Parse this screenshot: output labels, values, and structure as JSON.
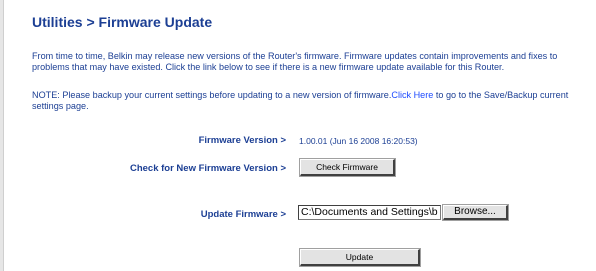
{
  "page": {
    "title": "Utilities > Firmware Update",
    "intro": "From time to time, Belkin may release new versions of the Router's firmware. Firmware updates contain improvements and fixes to problems that may have existed. Click the link below to see if there is a new firmware update available for this Router.",
    "note_prefix": "NOTE: Please backup your current settings before updating to a new version of firmware.",
    "note_link": "Click Here",
    "note_suffix": " to go to the Save/Backup current settings page."
  },
  "firmware": {
    "version_label": "Firmware Version >",
    "version_value": "1.00.01 (Jun 16 2008 16:20:53)",
    "check_label": "Check for New Firmware Version >",
    "check_button": "Check Firmware",
    "update_label": "Update Firmware >",
    "file_value": "C:\\Documents and Settings\\b",
    "browse_button": "Browse...",
    "update_button": "Update"
  }
}
